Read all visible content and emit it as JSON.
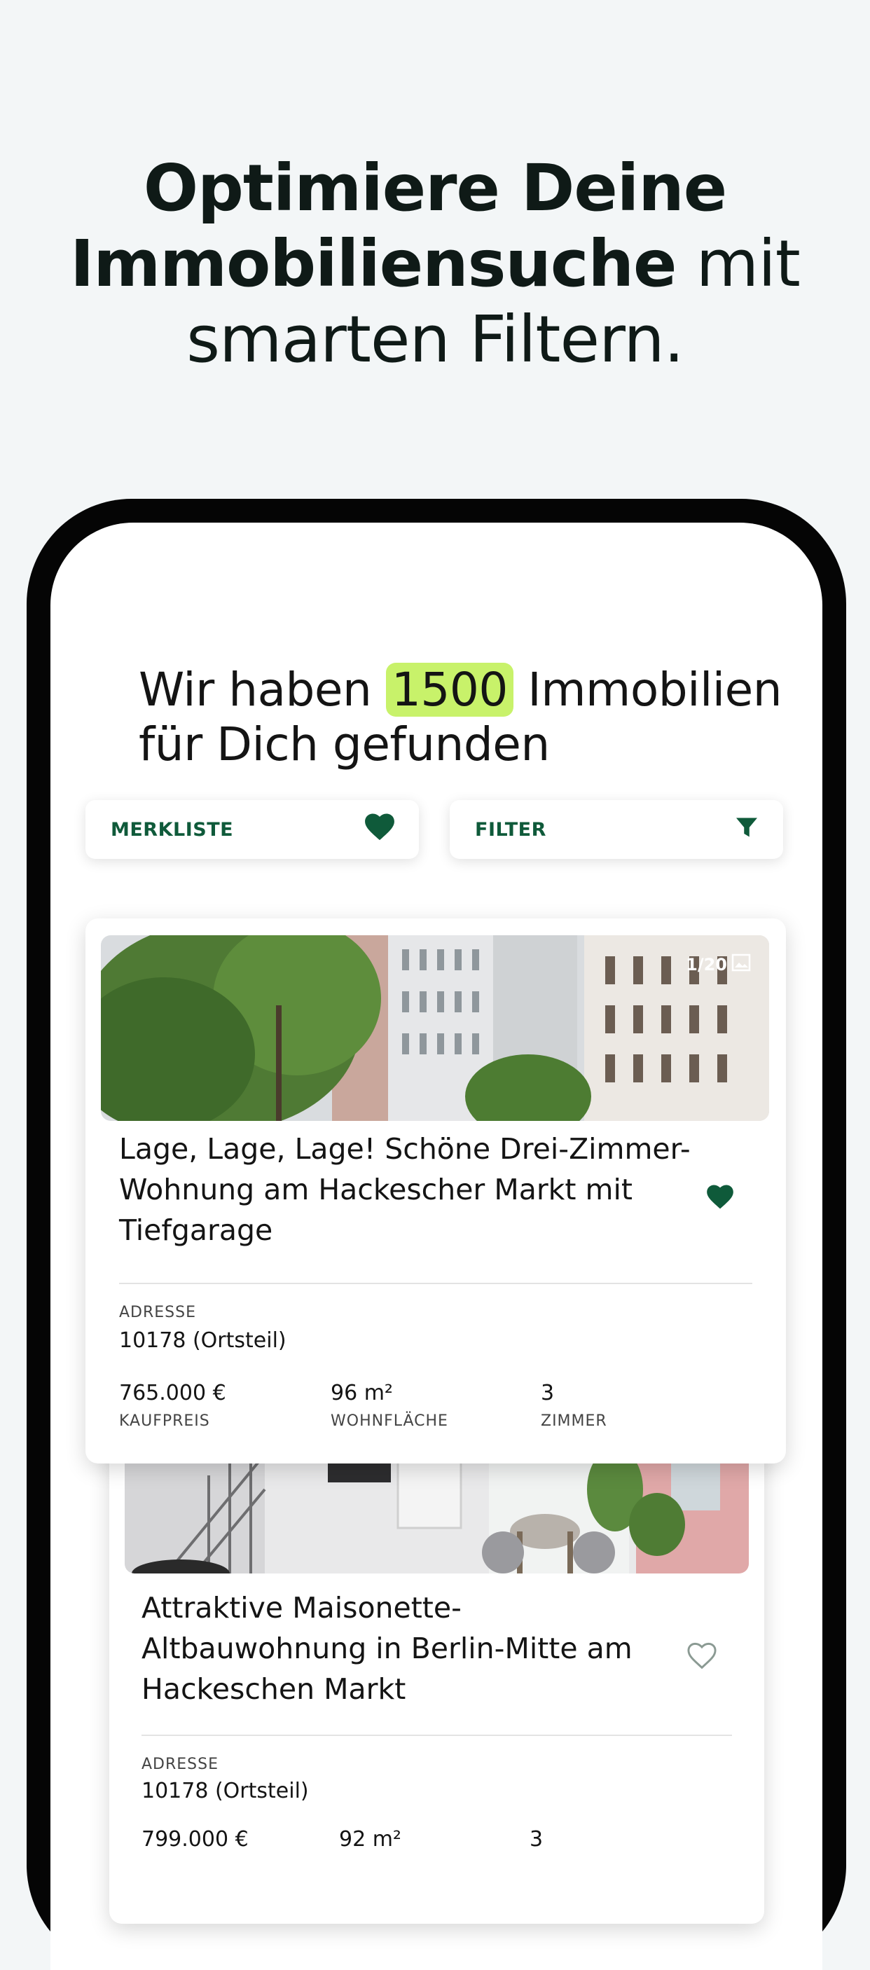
{
  "headline": {
    "line1": "Optimiere Deine",
    "line2_bold": "Immobiliensuche",
    "line2_rest": " mit",
    "line3": "smarten Filtern."
  },
  "results": {
    "prefix": "Wir haben ",
    "count": "1500",
    "suffix": " Immobilien",
    "line2": "für Dich gefunden"
  },
  "buttons": {
    "watchlist": "MERKLISTE",
    "filter": "FILTER"
  },
  "listings": [
    {
      "image_counter": "1/20",
      "title": "Lage, Lage, Lage! Schöne Drei-Zimmer-Wohnung am Hackescher Markt mit Tiefgarage",
      "favorited": true,
      "address_label": "ADRESSE",
      "address": "10178 (Ortsteil)",
      "price": "765.000 €",
      "price_label": "KAUFPREIS",
      "area": "96 m²",
      "area_label": "WOHNFLÄCHE",
      "rooms": "3",
      "rooms_label": "ZIMMER"
    },
    {
      "title": "Attraktive Maisonette-Altbauwohnung in Berlin-Mitte am Hackeschen Markt",
      "favorited": false,
      "address_label": "ADRESSE",
      "address": "10178 (Ortsteil)",
      "price": "799.000 €",
      "area": "92 m²",
      "rooms": "3"
    }
  ],
  "colors": {
    "accent_green": "#0f5a3a",
    "highlight": "#c8f26a",
    "background": "#f3f6f7"
  },
  "icons": [
    "heart-icon",
    "filter-icon",
    "gallery-icon",
    "heart-outline-icon"
  ]
}
